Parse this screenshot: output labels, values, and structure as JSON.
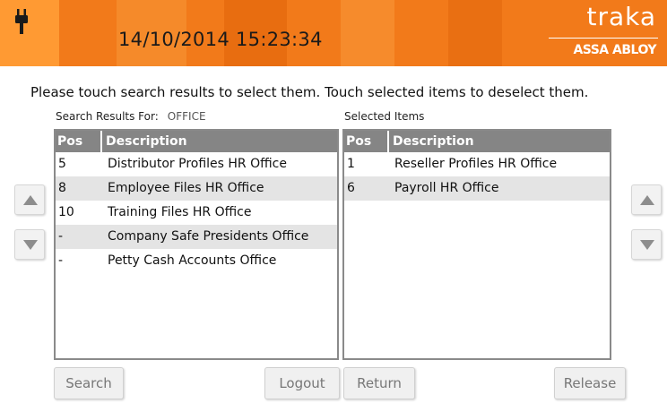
{
  "header": {
    "datetime": "14/10/2014 15:23:34",
    "logo_word": "traka",
    "logo_sub": "ASSA ABLOY",
    "background_color": "#f27a1a",
    "status_icon": "power-plug-icon"
  },
  "instructions": "Please touch search results to select them. Touch selected items to deselect them.",
  "search_results": {
    "caption": "Search Results For:",
    "term": "OFFICE",
    "columns": {
      "pos": "Pos",
      "description": "Description"
    },
    "rows": [
      {
        "pos": "5",
        "description": "Distributor Profiles HR Office"
      },
      {
        "pos": "8",
        "description": "Employee Files HR Office"
      },
      {
        "pos": "10",
        "description": "Training Files HR Office"
      },
      {
        "pos": "-",
        "description": "Company Safe Presidents Office"
      },
      {
        "pos": "-",
        "description": "Petty Cash Accounts Office"
      }
    ]
  },
  "selected_items": {
    "caption": "Selected Items",
    "columns": {
      "pos": "Pos",
      "description": "Description"
    },
    "rows": [
      {
        "pos": "1",
        "description": "Reseller Profiles HR Office"
      },
      {
        "pos": "6",
        "description": "Payroll HR Office"
      }
    ]
  },
  "buttons": {
    "search": "Search",
    "logout": "Logout",
    "return": "Return",
    "release": "Release"
  },
  "scroll_icons": {
    "up": "scroll-up-arrow-icon",
    "down": "scroll-down-arrow-icon"
  }
}
